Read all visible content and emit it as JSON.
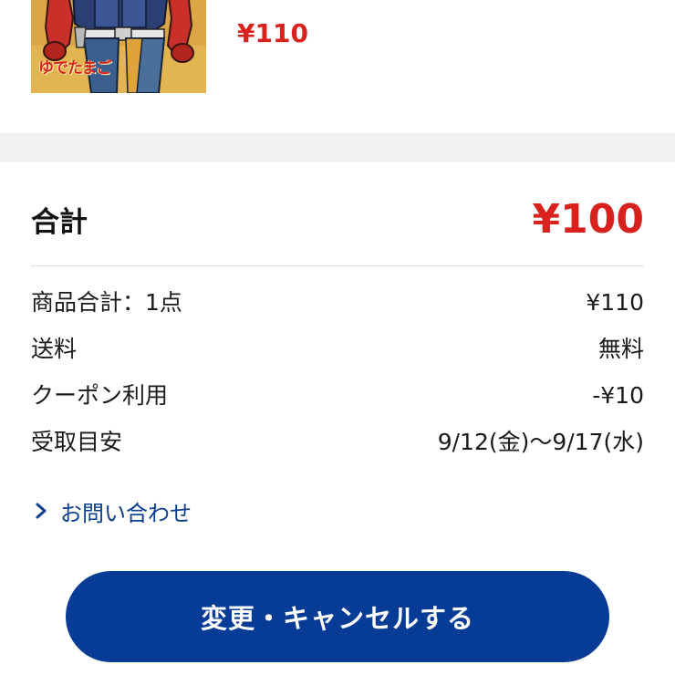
{
  "product": {
    "thumbnail_caption": "ゆでたまご",
    "price": "¥110"
  },
  "summary": {
    "total_label": "合計",
    "total_value": "¥100",
    "rows": [
      {
        "label": "商品合計：1点",
        "value": "¥110"
      },
      {
        "label": "送料",
        "value": "無料"
      },
      {
        "label": "クーポン利用",
        "value": "-¥10"
      },
      {
        "label": "受取目安",
        "value": "9/12(金)〜9/17(水)"
      }
    ]
  },
  "inquiry_link": {
    "label": "お問い合わせ",
    "icon": "chevron-right-icon"
  },
  "cta": {
    "label": "変更・キャンセルする"
  },
  "colors": {
    "price_red": "#d8221e",
    "link_blue": "#0a3f8f",
    "button_blue": "#063b96",
    "band_gray": "#f2f2f2"
  }
}
